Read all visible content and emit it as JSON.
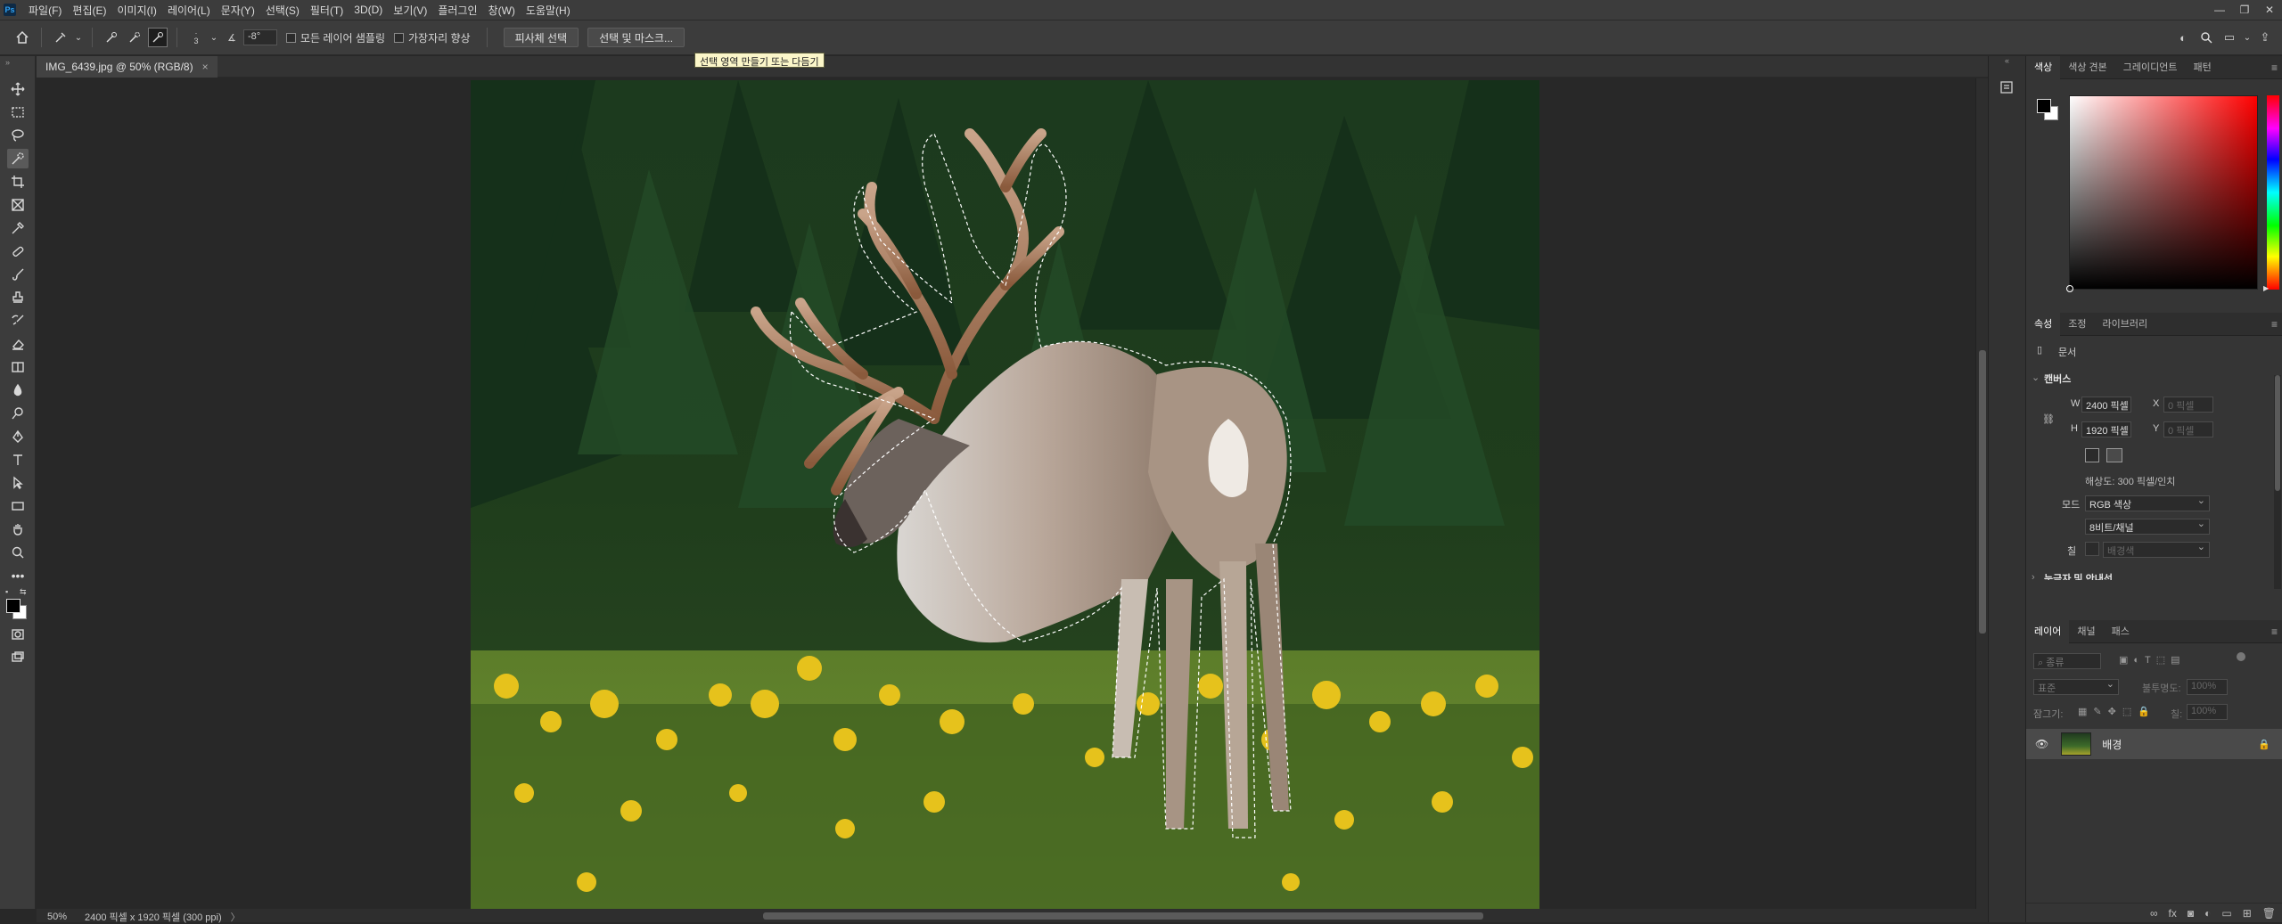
{
  "app": {
    "logo": "Ps"
  },
  "menu": [
    "파일(F)",
    "편집(E)",
    "이미지(I)",
    "레이어(L)",
    "문자(Y)",
    "선택(S)",
    "필터(T)",
    "3D(D)",
    "보기(V)",
    "플러그인",
    "창(W)",
    "도움말(H)"
  ],
  "options": {
    "brush_size": "3",
    "angle": "-8°",
    "sample_all_layers": "모든 레이어 샘플링",
    "enhance_edge": "가장자리 향상",
    "select_subject": "피사체 선택",
    "select_and_mask": "선택 및 마스크...",
    "tooltip": "선택 영역 만들기 또는 다듬기"
  },
  "document": {
    "tab_title": "IMG_6439.jpg @ 50% (RGB/8)",
    "zoom": "50%",
    "status_info": "2400 픽셀 x 1920 픽셀 (300 ppi)"
  },
  "color_panel": {
    "tabs": [
      "색상",
      "색상 견본",
      "그레이디언트",
      "패턴"
    ],
    "active_tab": "색상",
    "foreground": "#000000",
    "background": "#ffffff"
  },
  "properties_panel": {
    "tabs": [
      "속성",
      "조정",
      "라이브러리"
    ],
    "doc_label": "문서",
    "canvas_header": "캔버스",
    "w_label": "W",
    "w_value": "2400 픽셀",
    "x_label": "X",
    "x_placeholder": "0 픽셀",
    "h_label": "H",
    "h_value": "1920 픽셀",
    "y_label": "Y",
    "y_placeholder": "0 픽셀",
    "resolution": "해상도: 300 픽셀/인치",
    "mode_label": "모드",
    "mode_value": "RGB 색상",
    "depth_value": "8비트/채널",
    "fill_label": "칠",
    "fill_value": "배경색",
    "next_section": "눈금자 및 안내선"
  },
  "layers_panel": {
    "tabs": [
      "레이어",
      "채널",
      "패스"
    ],
    "search_placeholder": "종류",
    "blend_mode": "표준",
    "opacity_label": "불투명도:",
    "opacity_value": "100%",
    "lock_label": "잠그기:",
    "fill_label": "칠:",
    "fill_value": "100%",
    "layers": [
      {
        "name": "배경",
        "visible": true,
        "locked": true
      }
    ]
  }
}
